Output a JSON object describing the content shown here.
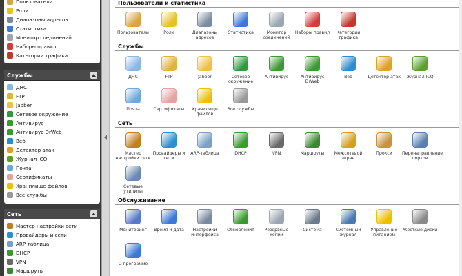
{
  "sidebar": {
    "panels": [
      {
        "title": "",
        "items": [
          {
            "label": "Пользователи",
            "color": "#d9a441"
          },
          {
            "label": "Роли",
            "color": "#e6c229"
          },
          {
            "label": "Диапазоны адресов",
            "color": "#7a8aa0"
          },
          {
            "label": "Статистика",
            "color": "#3c78d8"
          },
          {
            "label": "Монитор соединений",
            "color": "#9aa5b1"
          },
          {
            "label": "Наборы правил",
            "color": "#d23c3c"
          },
          {
            "label": "Категории трафика",
            "color": "#c0392b"
          }
        ]
      },
      {
        "title": "Службы",
        "items": [
          {
            "label": "ДНС",
            "color": "#8bb6e6"
          },
          {
            "label": "FTP",
            "color": "#e0b43c"
          },
          {
            "label": "Jabber",
            "color": "#f0c040"
          },
          {
            "label": "Сетевое окружение",
            "color": "#2e9a3c"
          },
          {
            "label": "Антивирус",
            "color": "#3a9a30"
          },
          {
            "label": "Антивирус DrWeb",
            "color": "#3a9a30"
          },
          {
            "label": "Веб",
            "color": "#2d8bd0"
          },
          {
            "label": "Детектор атак",
            "color": "#e2a020"
          },
          {
            "label": "Журнал ICQ",
            "color": "#5aa02c"
          },
          {
            "label": "Почта",
            "color": "#6fa8dc"
          },
          {
            "label": "Сертификаты",
            "color": "#e8a0a0"
          },
          {
            "label": "Хранилище файлов",
            "color": "#f0c000"
          },
          {
            "label": "Все службы",
            "color": "#999999"
          }
        ]
      },
      {
        "title": "Сеть",
        "items": [
          {
            "label": "Мастер настройки сети",
            "color": "#c08020"
          },
          {
            "label": "Провайдеры и сети",
            "color": "#2e8fd0"
          },
          {
            "label": "ARP-таблица",
            "color": "#7aa0c8"
          },
          {
            "label": "DHCP",
            "color": "#3a9a30"
          },
          {
            "label": "VPN",
            "color": "#6a6a6a"
          },
          {
            "label": "Маршруты",
            "color": "#3a8a30"
          }
        ]
      }
    ]
  },
  "main": {
    "sections": [
      {
        "title": "Пользователи и статистика",
        "tiles": [
          {
            "label": "Пользователи",
            "color": "#d9a441"
          },
          {
            "label": "Роли",
            "color": "#e6c229"
          },
          {
            "label": "Диапазоны адресов",
            "color": "#7a8aa0"
          },
          {
            "label": "Статистика",
            "color": "#3c78d8"
          },
          {
            "label": "Монитор соединений",
            "color": "#9aa5b1"
          },
          {
            "label": "Наборы правил",
            "color": "#d23c3c"
          },
          {
            "label": "Категории трафика",
            "color": "#c0392b"
          }
        ]
      },
      {
        "title": "Службы",
        "tiles": [
          {
            "label": "ДНС",
            "color": "#8bb6e6"
          },
          {
            "label": "FTP",
            "color": "#e0b43c"
          },
          {
            "label": "Jabber",
            "color": "#f0c040"
          },
          {
            "label": "Сетевое окружение",
            "color": "#2e9a3c"
          },
          {
            "label": "Антивирус",
            "color": "#3a9a30"
          },
          {
            "label": "Антивирус DrWeb",
            "color": "#3a9a30"
          },
          {
            "label": "Веб",
            "color": "#2d8bd0"
          },
          {
            "label": "Детектор атак",
            "color": "#e2a020"
          },
          {
            "label": "Журнал ICQ",
            "color": "#5aa02c"
          },
          {
            "label": "Почта",
            "color": "#6fa8dc"
          },
          {
            "label": "Сертификаты",
            "color": "#e8a0a0"
          },
          {
            "label": "Хранилище файлов",
            "color": "#f0c000"
          },
          {
            "label": "Все службы",
            "color": "#999999"
          }
        ]
      },
      {
        "title": "Сеть",
        "tiles": [
          {
            "label": "Мастер настройки сети",
            "color": "#c08020"
          },
          {
            "label": "Провайдеры и сети",
            "color": "#2e8fd0"
          },
          {
            "label": "ARP-таблица",
            "color": "#7aa0c8"
          },
          {
            "label": "DHCP",
            "color": "#3a9a30"
          },
          {
            "label": "VPN",
            "color": "#6a6a6a"
          },
          {
            "label": "Маршруты",
            "color": "#3a8a30"
          },
          {
            "label": "Межсетевой экран",
            "color": "#d4a020"
          },
          {
            "label": "Прокси",
            "color": "#c89040"
          },
          {
            "label": "Перенаправление портов",
            "color": "#5a7fb0"
          },
          {
            "label": "Сетевые утилиты",
            "color": "#6a8ab0"
          }
        ]
      },
      {
        "title": "Обслуживание",
        "tiles": [
          {
            "label": "Мониторинг",
            "color": "#5a78c8"
          },
          {
            "label": "Время и дата",
            "color": "#3c78d8"
          },
          {
            "label": "Настройки интерфейса",
            "color": "#7a8aa0"
          },
          {
            "label": "Обновления",
            "color": "#3a9a30"
          },
          {
            "label": "Резервные копии",
            "color": "#9aa5b1"
          },
          {
            "label": "Система",
            "color": "#6a7a8a"
          },
          {
            "label": "Системный журнал",
            "color": "#4a78b0"
          },
          {
            "label": "Управление питанием",
            "color": "#f0c000"
          },
          {
            "label": "Жесткие диски",
            "color": "#8a8a8a"
          },
          {
            "label": "О программе",
            "color": "#3c78d8"
          }
        ]
      }
    ]
  }
}
